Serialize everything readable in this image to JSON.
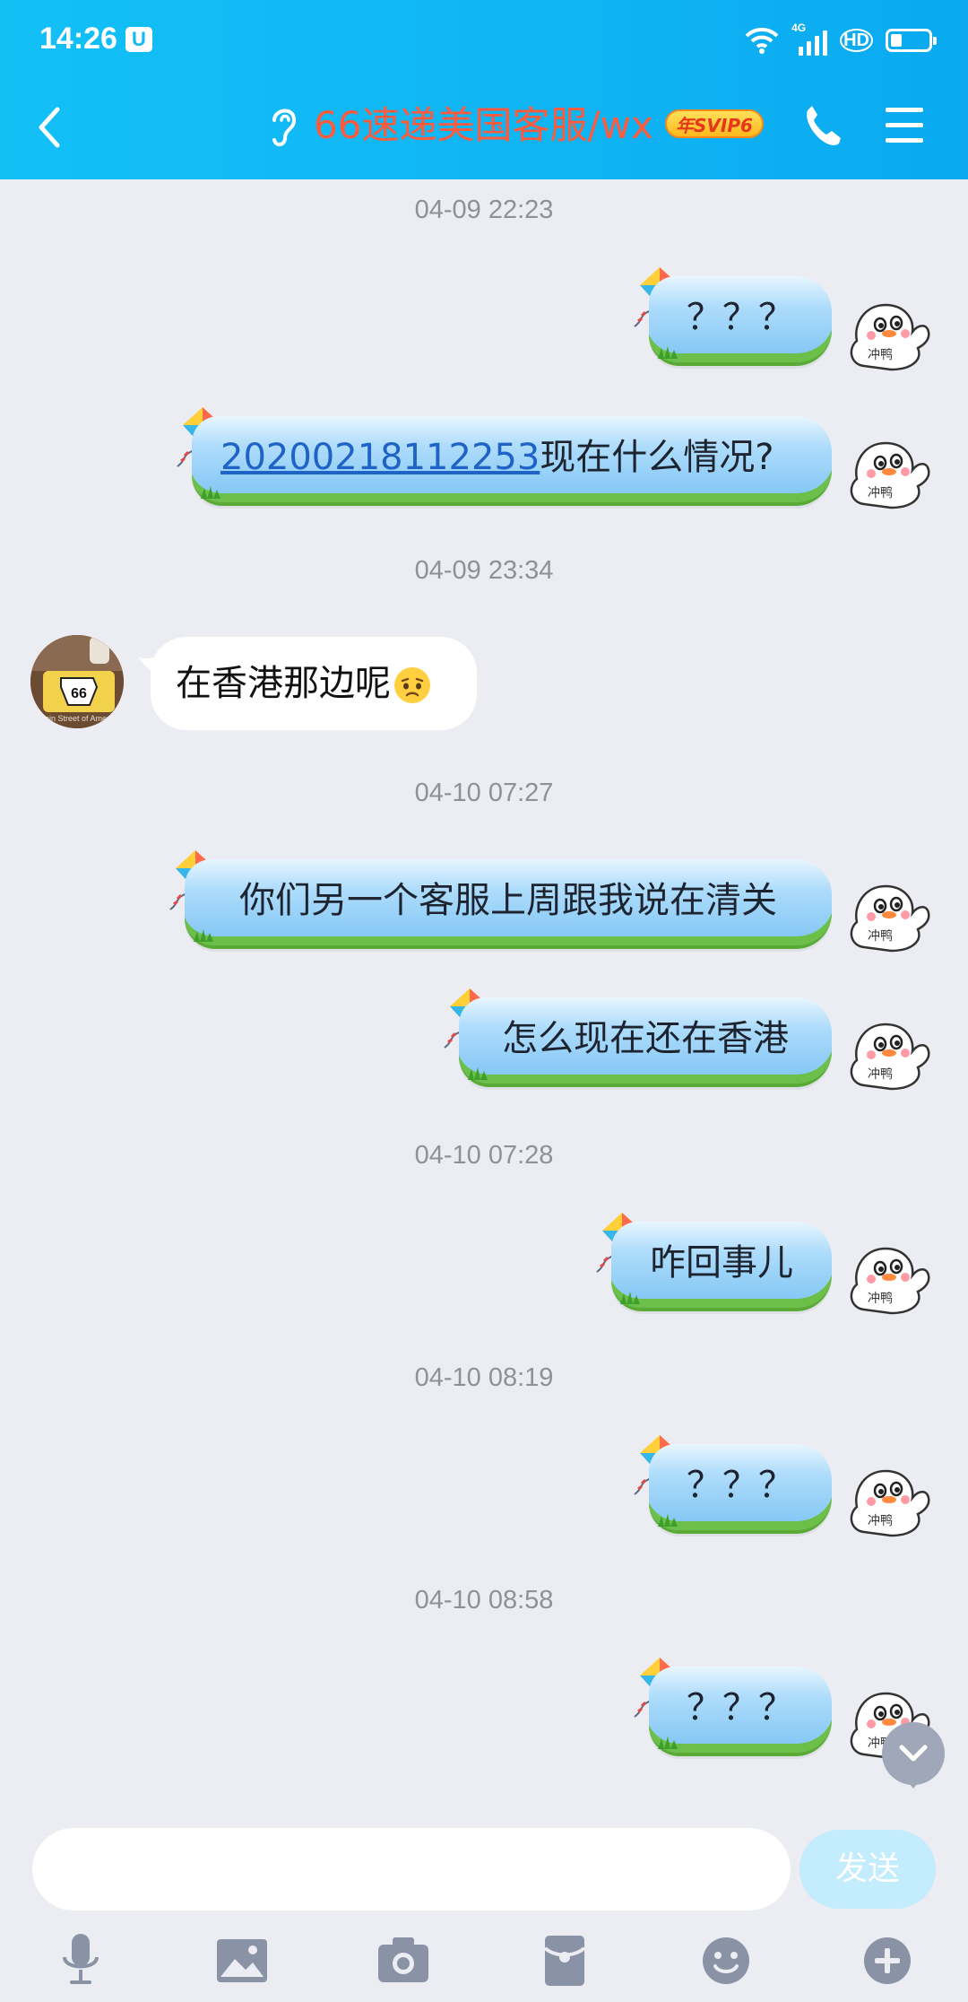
{
  "status_bar": {
    "time": "14:26",
    "network_label": "4G",
    "hd_label": "HD"
  },
  "header": {
    "title": "66速递美国客服/wx",
    "badge": "年SVIP6"
  },
  "messages": [
    {
      "type": "timestamp",
      "text": "04-09 22:23"
    },
    {
      "type": "outgoing",
      "text": "？？？"
    },
    {
      "type": "outgoing",
      "link": "20200218112253",
      "text": "现在什么情况?"
    },
    {
      "type": "timestamp",
      "text": "04-09 23:34"
    },
    {
      "type": "incoming",
      "text": "在香港那边呢"
    },
    {
      "type": "timestamp",
      "text": "04-10 07:27"
    },
    {
      "type": "outgoing",
      "text": "你们另一个客服上周跟我说在清关"
    },
    {
      "type": "outgoing",
      "text": "怎么现在还在香港"
    },
    {
      "type": "timestamp",
      "text": "04-10 07:28"
    },
    {
      "type": "outgoing",
      "text": "咋回事儿"
    },
    {
      "type": "timestamp",
      "text": "04-10 08:19"
    },
    {
      "type": "outgoing",
      "text": "？？？"
    },
    {
      "type": "timestamp",
      "text": "04-10 08:58"
    },
    {
      "type": "outgoing",
      "text": "？？？"
    }
  ],
  "sticker_label": "冲鸭",
  "input": {
    "placeholder": "",
    "send_label": "发送"
  },
  "toolbar": [
    "microphone-icon",
    "image-icon",
    "camera-icon",
    "red-packet-icon",
    "emoji-icon",
    "plus-icon"
  ],
  "colors": {
    "header": "#13c0f6",
    "title": "#ff5a3c",
    "chat_bg": "#ebedf2",
    "send_disabled": "#c3ecfc",
    "link": "#1f63c6"
  }
}
